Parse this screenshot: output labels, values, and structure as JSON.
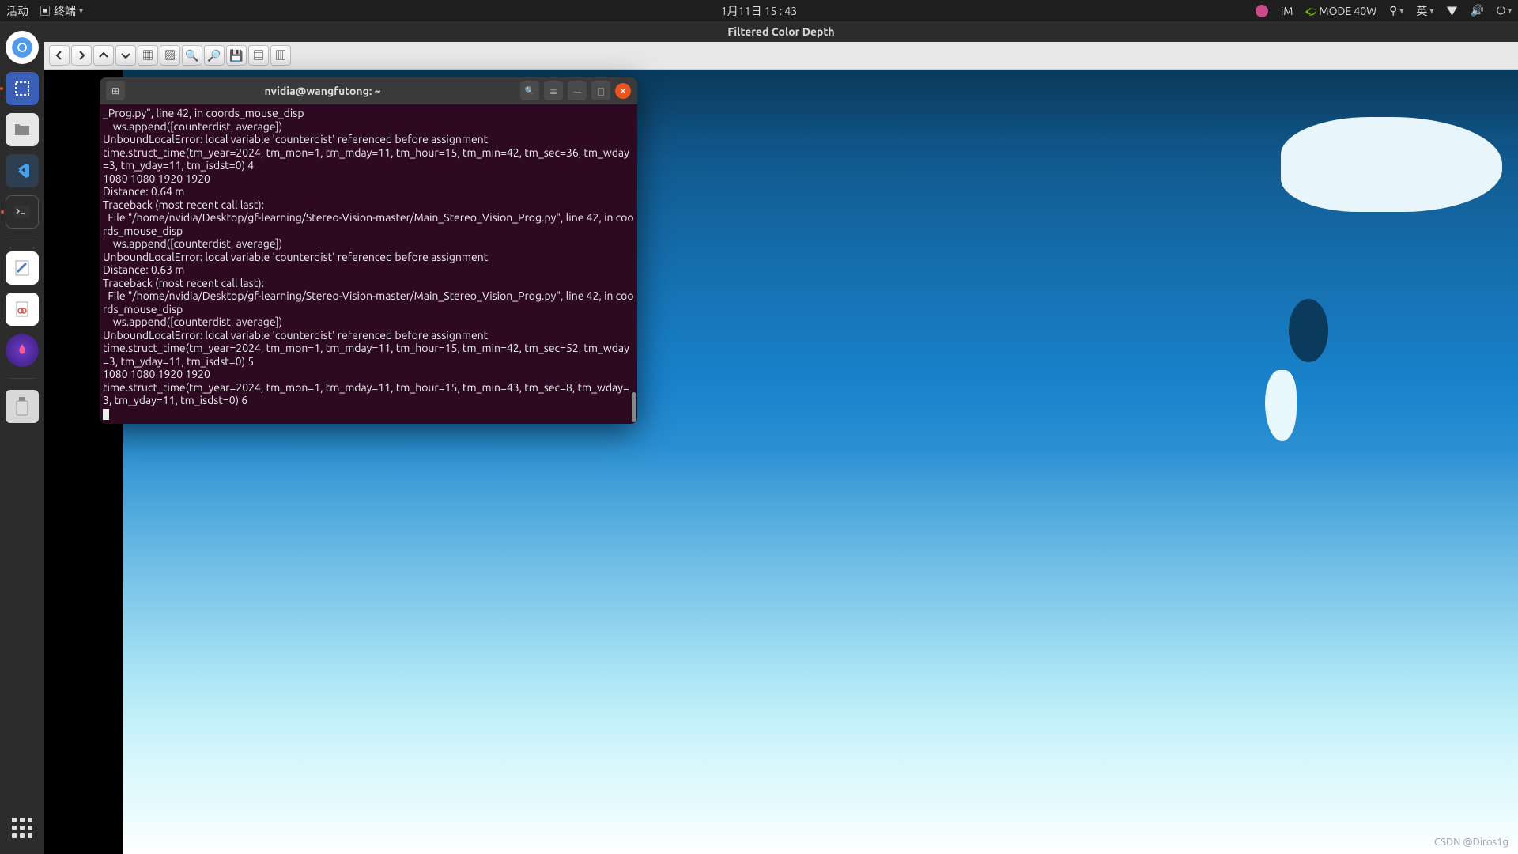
{
  "topbar": {
    "activities": "活动",
    "app_label": "终端",
    "datetime": "1月11日 15 : 43",
    "input_method_badge": "iM",
    "mode_label": "MODE 40W",
    "ime_lang": "英"
  },
  "window_title": "Filtered Color Depth",
  "terminal": {
    "title": "nvidia@wangfutong: ~",
    "lines": [
      "_Prog.py\", line 42, in coords_mouse_disp",
      "    ws.append([counterdist, average])",
      "UnboundLocalError: local variable 'counterdist' referenced before assignment",
      "time.struct_time(tm_year=2024, tm_mon=1, tm_mday=11, tm_hour=15, tm_min=42, tm_sec=36, tm_wday=3, tm_yday=11, tm_isdst=0) 4",
      "1080 1080 1920 1920",
      "Distance: 0.64 m",
      "Traceback (most recent call last):",
      "  File \"/home/nvidia/Desktop/gf-learning/Stereo-Vision-master/Main_Stereo_Vision_Prog.py\", line 42, in coords_mouse_disp",
      "    ws.append([counterdist, average])",
      "UnboundLocalError: local variable 'counterdist' referenced before assignment",
      "Distance: 0.63 m",
      "Traceback (most recent call last):",
      "  File \"/home/nvidia/Desktop/gf-learning/Stereo-Vision-master/Main_Stereo_Vision_Prog.py\", line 42, in coords_mouse_disp",
      "    ws.append([counterdist, average])",
      "UnboundLocalError: local variable 'counterdist' referenced before assignment",
      "time.struct_time(tm_year=2024, tm_mon=1, tm_mday=11, tm_hour=15, tm_min=42, tm_sec=52, tm_wday=3, tm_yday=11, tm_isdst=0) 5",
      "1080 1080 1920 1920",
      "time.struct_time(tm_year=2024, tm_mon=1, tm_mday=11, tm_hour=15, tm_min=43, tm_sec=8, tm_wday=3, tm_yday=11, tm_isdst=0) 6"
    ]
  },
  "watermark": "CSDN @Diros1g"
}
